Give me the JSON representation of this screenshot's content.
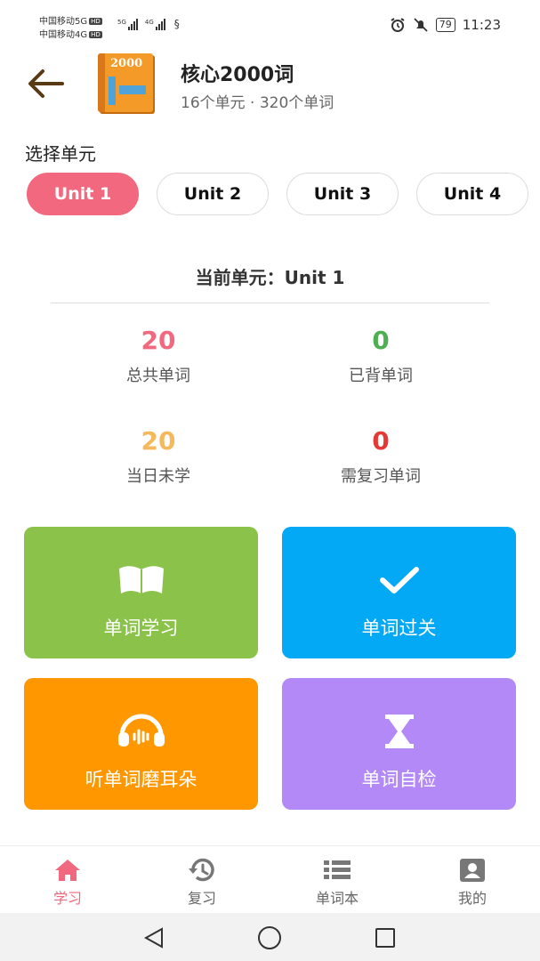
{
  "status_bar": {
    "carrier_1": "中国移动5G",
    "carrier_2": "中国移动4G",
    "hd_badge": "HD",
    "signal_1_label": "5G",
    "signal_2_label": "4G",
    "battery": "79",
    "time": "11:23"
  },
  "header": {
    "title": "核心2000词",
    "subtitle": "16个单元 · 320个单词",
    "book_cover_text": "2000"
  },
  "unit_picker": {
    "label": "选择单元",
    "units": [
      {
        "label": "Unit 1",
        "active": true
      },
      {
        "label": "Unit 2",
        "active": false
      },
      {
        "label": "Unit 3",
        "active": false
      },
      {
        "label": "Unit 4",
        "active": false
      }
    ]
  },
  "current_unit": "当前单元：Unit 1",
  "stats": [
    {
      "value": "20",
      "label": "总共单词",
      "color": "#f2687e"
    },
    {
      "value": "0",
      "label": "已背单词",
      "color": "#4caf50"
    },
    {
      "value": "20",
      "label": "当日未学",
      "color": "#f5b85b"
    },
    {
      "value": "0",
      "label": "需复习单词",
      "color": "#e53935"
    }
  ],
  "actions": [
    {
      "label": "单词学习",
      "icon": "open-book-icon",
      "color": "#8bc34a"
    },
    {
      "label": "单词过关",
      "icon": "checkmark-icon",
      "color": "#03a9f4"
    },
    {
      "label": "听单词磨耳朵",
      "icon": "headphones-icon",
      "color": "#ff9800"
    },
    {
      "label": "单词自检",
      "icon": "hourglass-icon",
      "color": "#b388f7"
    }
  ],
  "bottom_nav": [
    {
      "label": "学习",
      "icon": "home-icon",
      "active": true
    },
    {
      "label": "复习",
      "icon": "history-icon",
      "active": false
    },
    {
      "label": "单词本",
      "icon": "list-icon",
      "active": false
    },
    {
      "label": "我的",
      "icon": "profile-icon",
      "active": false
    }
  ],
  "colors": {
    "accent": "#f2687e",
    "nav_inactive": "#666666"
  }
}
